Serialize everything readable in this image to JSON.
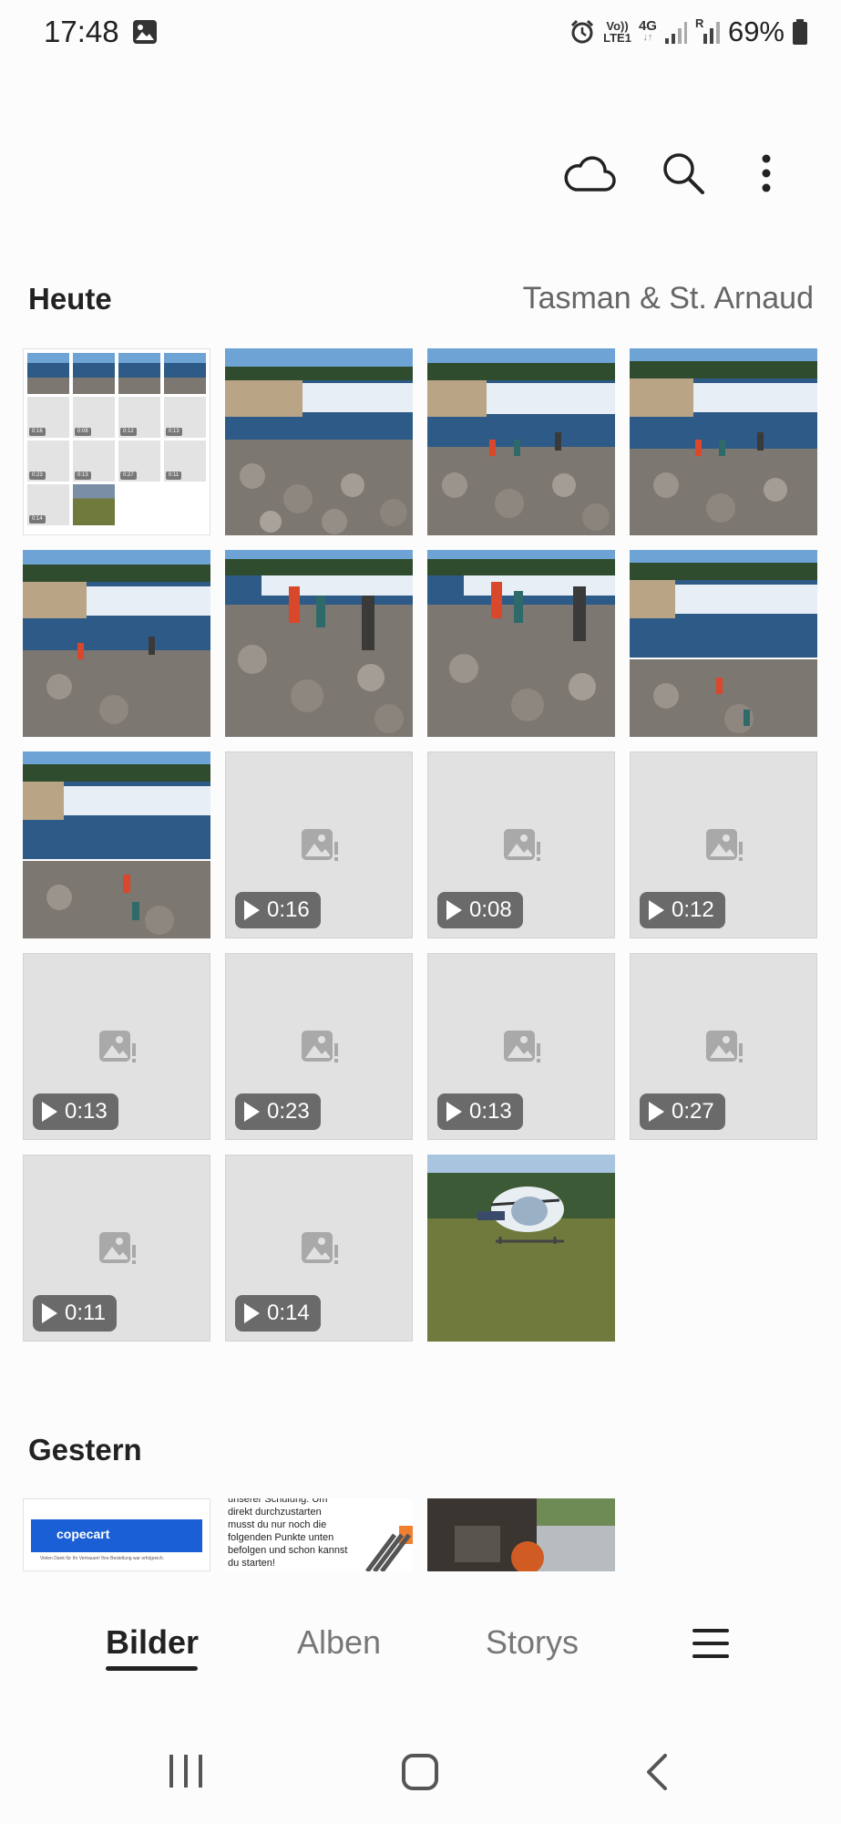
{
  "status_bar": {
    "time": "17:48",
    "network_label_top": "Vo))",
    "network_label_bottom": "LTE1",
    "network_type": "4G",
    "roaming_indicator": "R",
    "battery_percent": "69%",
    "icons": [
      "gallery-notification-icon",
      "alarm-icon",
      "volte-icon",
      "4g-icon",
      "signal-icon",
      "signal-roaming-icon",
      "battery-icon"
    ]
  },
  "toolbar": {
    "icons": [
      "cloud-icon",
      "search-icon",
      "more-options-icon"
    ]
  },
  "sections": {
    "today": {
      "title": "Heute",
      "location": "Tasman & St. Arnaud",
      "collage_durations": [
        "0:16",
        "0:08",
        "0:12",
        "0:13",
        "0:23",
        "0:13",
        "0:27",
        "0:11",
        "0:14"
      ],
      "items": [
        {
          "kind": "collage"
        },
        {
          "kind": "photo",
          "subject": "waterfall"
        },
        {
          "kind": "photo",
          "subject": "waterfall-people"
        },
        {
          "kind": "photo",
          "subject": "waterfall-people"
        },
        {
          "kind": "photo",
          "subject": "waterfall-people"
        },
        {
          "kind": "photo",
          "subject": "people-on-rocks"
        },
        {
          "kind": "photo",
          "subject": "people-on-rocks"
        },
        {
          "kind": "photo",
          "subject": "waterfall-people"
        },
        {
          "kind": "photo",
          "subject": "waterfall-people"
        },
        {
          "kind": "video",
          "duration": "0:16"
        },
        {
          "kind": "video",
          "duration": "0:08"
        },
        {
          "kind": "video",
          "duration": "0:12"
        },
        {
          "kind": "video",
          "duration": "0:13"
        },
        {
          "kind": "video",
          "duration": "0:23"
        },
        {
          "kind": "video",
          "duration": "0:13"
        },
        {
          "kind": "video",
          "duration": "0:27"
        },
        {
          "kind": "video",
          "duration": "0:11"
        },
        {
          "kind": "video",
          "duration": "0:14"
        },
        {
          "kind": "photo",
          "subject": "helicopter"
        }
      ]
    },
    "yesterday": {
      "title": "Gestern",
      "thumb1_brand": "copecart",
      "thumb1_caption": "Vielen Dank für Ihr Vertrauen! Ihre Bestellung war erfolgreich.",
      "thumb2_lines": [
        "unserer Schulung. Um",
        "direkt durchzustarten",
        "musst du nur noch die",
        "folgenden Punkte unten",
        "befolgen und schon kannst",
        "du starten!"
      ]
    }
  },
  "bottom_nav": {
    "tabs": [
      {
        "label": "Bilder",
        "active": true
      },
      {
        "label": "Alben",
        "active": false
      },
      {
        "label": "Storys",
        "active": false
      }
    ],
    "menu_icon": "hamburger-menu-icon"
  },
  "system_nav": {
    "icons": [
      "recent-apps-icon",
      "home-icon",
      "back-icon"
    ]
  },
  "colors": {
    "background": "#fcfcfc",
    "placeholder": "#e1e1e1",
    "duration_badge": "#6a6a6a",
    "text_primary": "#222222",
    "text_secondary": "#777777",
    "copecart_blue": "#1a5fd6"
  }
}
